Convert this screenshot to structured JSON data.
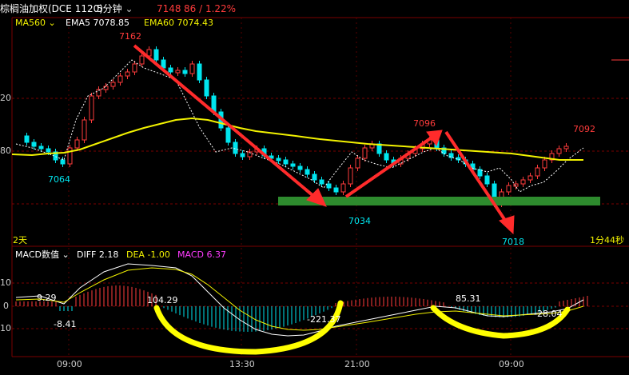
{
  "header": {
    "title": "棕榈油加权(DCE 1120)",
    "period": "5分钟",
    "period_icon": "chevron-down-icon",
    "last_price": "7148",
    "change": "86 / 1.22%"
  },
  "main_legend": {
    "ma_label": "MA560",
    "ema5": "EMA5 7078.85",
    "ema60": "EMA60 7074.43"
  },
  "price_axis": {
    "label_1": "20",
    "label_2": "80"
  },
  "annotations": {
    "high_1": "7162",
    "low_1": "7064",
    "low_2": "7034",
    "high_2": "7096",
    "low_3": "7018",
    "high_3": "7092"
  },
  "main_footer": {
    "left": "2天",
    "right": "1分44秒"
  },
  "macd_legend": {
    "name": "MACD数值",
    "diff": "DIFF 2.18",
    "dea": "DEA -1.00",
    "macd": "MACD 6.37"
  },
  "macd_axis": {
    "upper": "10",
    "zero": "0",
    "lower": "10"
  },
  "macd_annotations": {
    "v1": "9.29",
    "v2": "-8.41",
    "v3": "104.29",
    "v4": "-221.37",
    "v5": "85.31",
    "v6": "-28.04"
  },
  "time_axis": [
    "09:00",
    "13:30",
    "21:00",
    "09:00"
  ],
  "colors": {
    "up": "#ff3b3b",
    "down": "#00e5ee",
    "ma_line": "#f2f200",
    "arrow": "#ff2b2b",
    "support": "#2e8b2e",
    "highlight": "#ffff00",
    "grid": "#7a0000"
  },
  "chart_data": {
    "type": "candlestick",
    "series": [
      {
        "name": "price",
        "points": [
          {
            "label": "high",
            "value": 7162
          },
          {
            "label": "low",
            "value": 7064
          },
          {
            "label": "low",
            "value": 7034
          },
          {
            "label": "high",
            "value": 7096
          },
          {
            "label": "low",
            "value": 7018
          },
          {
            "label": "high",
            "value": 7092
          }
        ]
      }
    ]
  }
}
